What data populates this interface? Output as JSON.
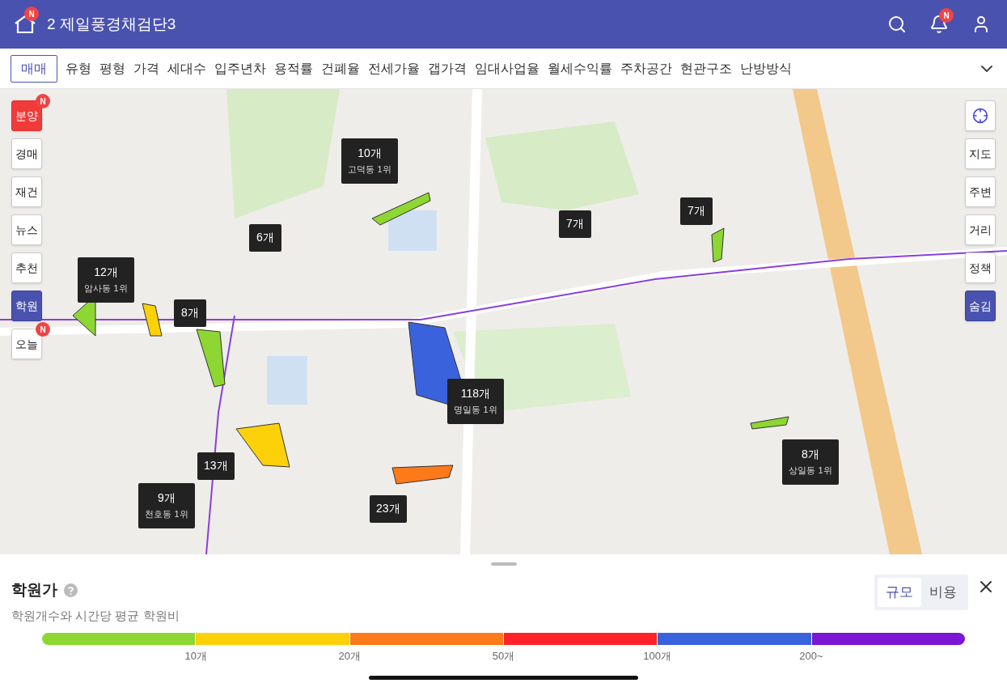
{
  "header": {
    "title": "2 제일풍경채검단3",
    "home_badge": "N",
    "bell_badge": "N"
  },
  "filter_tabs": [
    {
      "label": "매매",
      "selected": true
    },
    {
      "label": "유형",
      "selected": false
    },
    {
      "label": "평형",
      "selected": false
    },
    {
      "label": "가격",
      "selected": false
    },
    {
      "label": "세대수",
      "selected": false
    },
    {
      "label": "입주년차",
      "selected": false
    },
    {
      "label": "용적률",
      "selected": false
    },
    {
      "label": "건폐율",
      "selected": false
    },
    {
      "label": "전세가율",
      "selected": false
    },
    {
      "label": "갭가격",
      "selected": false
    },
    {
      "label": "임대사업율",
      "selected": false
    },
    {
      "label": "월세수익률",
      "selected": false
    },
    {
      "label": "주차공간",
      "selected": false
    },
    {
      "label": "현관구조",
      "selected": false
    },
    {
      "label": "난방방식",
      "selected": false
    }
  ],
  "left_buttons": [
    {
      "label": "분양",
      "kind": "accent",
      "badge": "N",
      "selected": false
    },
    {
      "label": "경매",
      "kind": "plain",
      "selected": false
    },
    {
      "label": "재건",
      "kind": "plain",
      "selected": false
    },
    {
      "label": "뉴스",
      "kind": "plain",
      "selected": false
    },
    {
      "label": "추천",
      "kind": "plain",
      "selected": false
    },
    {
      "label": "학원",
      "kind": "plain",
      "selected": true
    },
    {
      "label": "오늘",
      "kind": "plain",
      "badge": "N",
      "selected": false
    }
  ],
  "right_buttons": [
    {
      "kind": "locate",
      "selected": false
    },
    {
      "label": "지도",
      "kind": "text",
      "selected": false
    },
    {
      "label": "주변",
      "kind": "text",
      "selected": false
    },
    {
      "label": "거리",
      "kind": "text",
      "selected": false
    },
    {
      "label": "정책",
      "kind": "text",
      "selected": false
    },
    {
      "label": "숨김",
      "kind": "text",
      "selected": true
    }
  ],
  "markers": [
    {
      "count": "10개",
      "rank": "고덕동 1위"
    },
    {
      "count": "6개"
    },
    {
      "count": "12개",
      "rank": "암사동 1위"
    },
    {
      "count": "8개"
    },
    {
      "count": "7개"
    },
    {
      "count": "7개"
    },
    {
      "count": "118개",
      "rank": "명일동 1위"
    },
    {
      "count": "13개"
    },
    {
      "count": "9개",
      "rank": "천호동 1위"
    },
    {
      "count": "23개"
    },
    {
      "count": "8개",
      "rank": "상일동 1위"
    }
  ],
  "panel": {
    "title": "학원가",
    "subtitle": "학원개수와 시간당 평균 학원비",
    "toggle": [
      {
        "label": "규모",
        "selected": true
      },
      {
        "label": "비용",
        "selected": false
      }
    ],
    "legend": [
      {
        "color": "#8ed632",
        "label": "10개"
      },
      {
        "color": "#fdd10a",
        "label": "20개"
      },
      {
        "color": "#fd7a1a",
        "label": "50개"
      },
      {
        "color": "#fd2328",
        "label": "100개"
      },
      {
        "color": "#3b62dd",
        "label": "200~"
      },
      {
        "color": "#7b16d2"
      }
    ]
  }
}
